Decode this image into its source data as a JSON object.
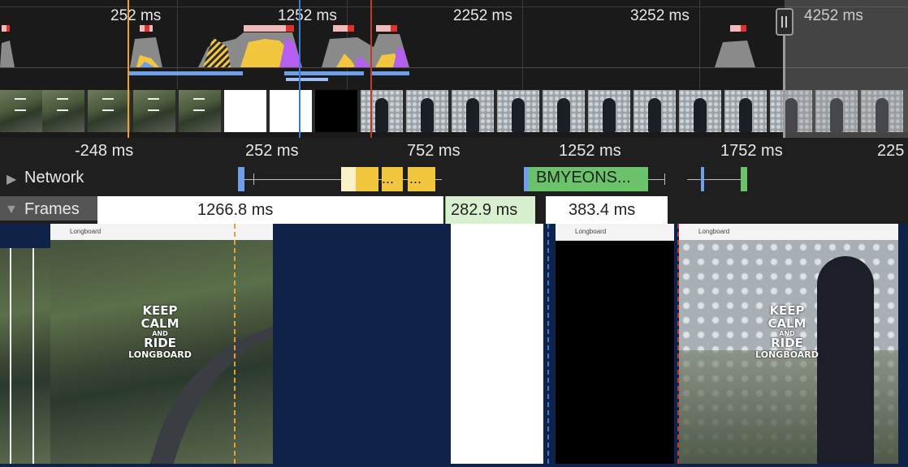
{
  "overview": {
    "ticks": [
      "252 ms",
      "1252 ms",
      "2252 ms",
      "3252 ms",
      "4252 ms"
    ]
  },
  "ruler": {
    "ticks": [
      "-248 ms",
      "252 ms",
      "752 ms",
      "1252 ms",
      "1752 ms",
      "225"
    ]
  },
  "network": {
    "label": "Network",
    "request_label": "BMYEONS...",
    "ellipsis_1": "...",
    "ellipsis_2": "..."
  },
  "frames": {
    "label": "Frames",
    "durations": [
      "1266.8 ms",
      "282.9 ms",
      "383.4 ms"
    ]
  },
  "screenshots": {
    "tab_title": "Longboard",
    "poster_keep": "KEEP",
    "poster_calm": "CALM",
    "poster_and": "AND",
    "poster_ride": "RIDE",
    "poster_longboard": "LONGBOARD"
  },
  "colors": {
    "scripting": "#f3c63f",
    "rendering": "#b45ff0",
    "system": "#8a8a8a",
    "network_blue": "#6f9fe8",
    "network_green": "#6ac26a",
    "frames_bg": "#0f2248"
  },
  "icons": {
    "expand": "triangle-right",
    "collapse": "triangle-down",
    "handle": "grip-handle"
  }
}
